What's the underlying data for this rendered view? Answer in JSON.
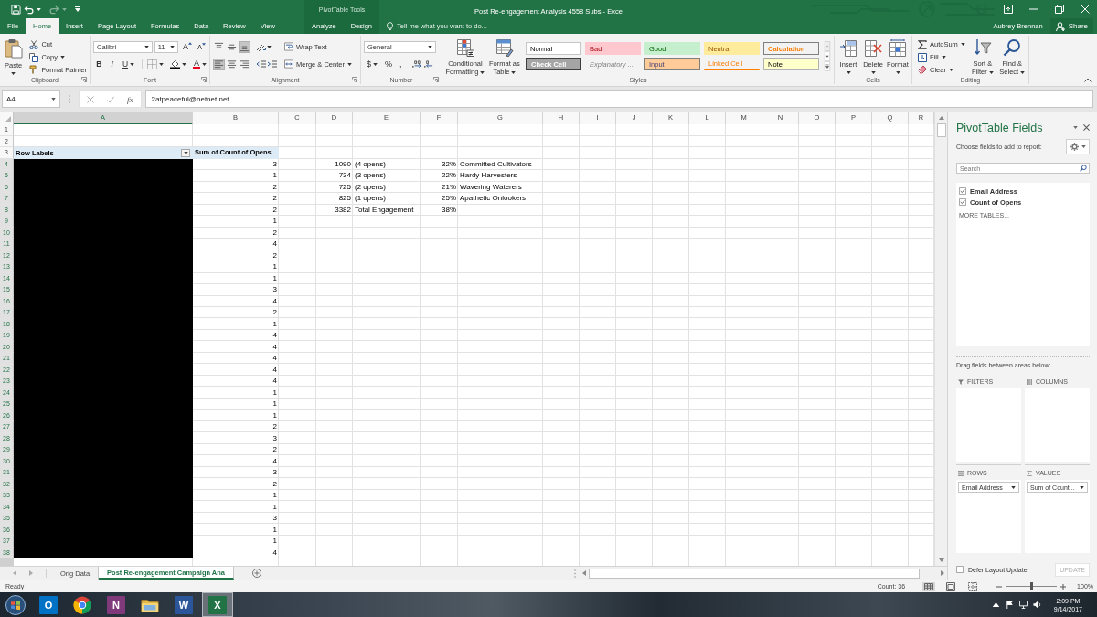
{
  "title_bar": {
    "title": "Post Re-engagement Analysis 4558 Subs - Excel"
  },
  "quick_access": [
    {
      "kind": "save",
      "disabled": false
    },
    {
      "kind": "undo",
      "disabled": false
    },
    {
      "kind": "redo",
      "disabled": true
    }
  ],
  "tabs": [
    {
      "label": "File",
      "selected": false
    },
    {
      "label": "Home",
      "selected": true
    },
    {
      "label": "Insert",
      "selected": false
    },
    {
      "label": "Page Layout",
      "selected": false
    },
    {
      "label": "Formulas",
      "selected": false
    },
    {
      "label": "Data",
      "selected": false
    },
    {
      "label": "Review",
      "selected": false
    },
    {
      "label": "View",
      "selected": false
    }
  ],
  "contextual_tab_group": {
    "label": "PivotTable Tools",
    "tabs": [
      {
        "label": "Analyze",
        "selected": false
      },
      {
        "label": "Design",
        "selected": false
      }
    ]
  },
  "tell_me": {
    "placeholder": "Tell me what you want to do..."
  },
  "account": {
    "user": "Aubrey Brennan",
    "share": "Share"
  },
  "ribbon": {
    "clipboard": {
      "paste": "Paste",
      "items": [
        {
          "label": "Cut",
          "kind": "cut"
        },
        {
          "label": "Copy",
          "kind": "copy"
        },
        {
          "label": "Format Painter",
          "kind": "painter"
        }
      ],
      "label": "Clipboard"
    },
    "font": {
      "name": "Calibri",
      "size": "11",
      "grow": "A",
      "shrink": "A",
      "styles": [
        {
          "label": "B",
          "kind": "bold"
        },
        {
          "label": "I",
          "kind": "italic"
        },
        {
          "label": "U",
          "kind": "underline"
        }
      ],
      "text_color_button": "A",
      "label": "Font"
    },
    "alignment": {
      "vertical": [
        {
          "kind": "top",
          "selected": false
        },
        {
          "kind": "middle",
          "selected": false
        },
        {
          "kind": "bottom",
          "selected": true
        }
      ],
      "horizontal": [
        {
          "kind": "left",
          "selected": true
        },
        {
          "kind": "center",
          "selected": false
        },
        {
          "kind": "right",
          "selected": false
        }
      ],
      "wrap_text": "Wrap Text",
      "merge": "Merge & Center",
      "label": "Alignment"
    },
    "number": {
      "format": "General",
      "symbols": [
        {
          "label": "$",
          "kind": "currency"
        },
        {
          "label": "%",
          "kind": "percent"
        },
        {
          "label": ",",
          "kind": "comma"
        }
      ],
      "label": "Number"
    },
    "styles": {
      "conditional": "Conditional Formatting",
      "format_table": "Format as Table",
      "cell_styles": [
        {
          "label": "Normal",
          "kind": "normal"
        },
        {
          "label": "Bad",
          "kind": "bad"
        },
        {
          "label": "Good",
          "kind": "good"
        },
        {
          "label": "Neutral",
          "kind": "neutral"
        },
        {
          "label": "Calculation",
          "kind": "calculation"
        },
        {
          "label": "Check Cell",
          "kind": "check"
        },
        {
          "label": "Explanatory ...",
          "kind": "explanatory"
        },
        {
          "label": "Input",
          "kind": "input"
        },
        {
          "label": "Linked Cell",
          "kind": "linked"
        },
        {
          "label": "Note",
          "kind": "note"
        }
      ],
      "label": "Styles"
    },
    "cells": {
      "buttons": [
        {
          "label": "Insert",
          "kind": "insert"
        },
        {
          "label": "Delete",
          "kind": "delete"
        },
        {
          "label": "Format",
          "kind": "format"
        }
      ],
      "label": "Cells"
    },
    "editing": {
      "items": [
        {
          "label": "AutoSum",
          "kind": "autosum"
        },
        {
          "label": "Fill",
          "kind": "fill"
        },
        {
          "label": "Clear",
          "kind": "clear"
        }
      ],
      "sort": "Sort & Filter",
      "find": "Find & Select",
      "label": "Editing"
    }
  },
  "formula_bar": {
    "name_box": "A4",
    "function_label": "fx",
    "value": "2atpeaceful@netnet.net"
  },
  "sheet": {
    "columns": [
      {
        "label": "A",
        "selected": true
      },
      {
        "label": "B",
        "selected": false
      },
      {
        "label": "C",
        "selected": false
      },
      {
        "label": "D",
        "selected": false
      },
      {
        "label": "E",
        "selected": false
      },
      {
        "label": "F",
        "selected": false
      },
      {
        "label": "G",
        "selected": false
      },
      {
        "label": "H",
        "selected": false
      },
      {
        "label": "I",
        "selected": false
      },
      {
        "label": "J",
        "selected": false
      },
      {
        "label": "K",
        "selected": false
      },
      {
        "label": "L",
        "selected": false
      },
      {
        "label": "M",
        "selected": false
      },
      {
        "label": "N",
        "selected": false
      },
      {
        "label": "O",
        "selected": false
      },
      {
        "label": "P",
        "selected": false
      },
      {
        "label": "Q",
        "selected": false
      },
      {
        "label": "R",
        "selected": false
      }
    ],
    "rows": [
      {
        "number": "1",
        "kind": "plain",
        "selected": false,
        "redacted": false
      },
      {
        "number": "2",
        "kind": "plain",
        "selected": false,
        "redacted": false
      },
      {
        "number": "3",
        "kind": "pivot_header",
        "selected": false,
        "redacted": false,
        "a": "Row Labels",
        "b": "Sum of Count of Opens"
      },
      {
        "number": "4",
        "kind": "plain",
        "selected": true,
        "redacted": true,
        "b": "3",
        "d": "1090",
        "e": "(4 opens)",
        "f": "32%",
        "g": "Committed Cultivators"
      },
      {
        "number": "5",
        "kind": "plain",
        "selected": true,
        "redacted": true,
        "b": "1",
        "d": "734",
        "e": "(3 opens)",
        "f": "22%",
        "g": "Hardy Harvesters"
      },
      {
        "number": "6",
        "kind": "plain",
        "selected": true,
        "redacted": true,
        "b": "2",
        "d": "725",
        "e": "(2 opens)",
        "f": "21%",
        "g": "Wavering Waterers"
      },
      {
        "number": "7",
        "kind": "plain",
        "selected": true,
        "redacted": true,
        "b": "2",
        "d": "825",
        "e": "(1 opens)",
        "f": "25%",
        "g": "Apathetic Onlookers"
      },
      {
        "number": "8",
        "kind": "plain",
        "selected": true,
        "redacted": true,
        "b": "2",
        "d": "3382",
        "e": "Total Engagement",
        "f": "38%"
      },
      {
        "number": "9",
        "kind": "plain",
        "selected": true,
        "redacted": true,
        "b": "1"
      },
      {
        "number": "10",
        "kind": "plain",
        "selected": true,
        "redacted": true,
        "b": "2"
      },
      {
        "number": "11",
        "kind": "plain",
        "selected": true,
        "redacted": true,
        "b": "4"
      },
      {
        "number": "12",
        "kind": "plain",
        "selected": true,
        "redacted": true,
        "b": "2"
      },
      {
        "number": "13",
        "kind": "plain",
        "selected": true,
        "redacted": true,
        "b": "1"
      },
      {
        "number": "14",
        "kind": "plain",
        "selected": true,
        "redacted": true,
        "b": "1"
      },
      {
        "number": "15",
        "kind": "plain",
        "selected": true,
        "redacted": true,
        "b": "3"
      },
      {
        "number": "16",
        "kind": "plain",
        "selected": true,
        "redacted": true,
        "b": "4"
      },
      {
        "number": "17",
        "kind": "plain",
        "selected": true,
        "redacted": true,
        "b": "2"
      },
      {
        "number": "18",
        "kind": "plain",
        "selected": true,
        "redacted": true,
        "b": "1"
      },
      {
        "number": "19",
        "kind": "plain",
        "selected": true,
        "redacted": true,
        "b": "4"
      },
      {
        "number": "20",
        "kind": "plain",
        "selected": true,
        "redacted": true,
        "b": "4"
      },
      {
        "number": "21",
        "kind": "plain",
        "selected": true,
        "redacted": true,
        "b": "4"
      },
      {
        "number": "22",
        "kind": "plain",
        "selected": true,
        "redacted": true,
        "b": "4"
      },
      {
        "number": "23",
        "kind": "plain",
        "selected": true,
        "redacted": true,
        "b": "4"
      },
      {
        "number": "24",
        "kind": "plain",
        "selected": true,
        "redacted": true,
        "b": "1"
      },
      {
        "number": "25",
        "kind": "plain",
        "selected": true,
        "redacted": true,
        "b": "1"
      },
      {
        "number": "26",
        "kind": "plain",
        "selected": true,
        "redacted": true,
        "b": "1"
      },
      {
        "number": "27",
        "kind": "plain",
        "selected": true,
        "redacted": true,
        "b": "2"
      },
      {
        "number": "28",
        "kind": "plain",
        "selected": true,
        "redacted": true,
        "b": "3"
      },
      {
        "number": "29",
        "kind": "plain",
        "selected": true,
        "redacted": true,
        "b": "2"
      },
      {
        "number": "30",
        "kind": "plain",
        "selected": true,
        "redacted": true,
        "b": "4"
      },
      {
        "number": "31",
        "kind": "plain",
        "selected": true,
        "redacted": true,
        "b": "3"
      },
      {
        "number": "32",
        "kind": "plain",
        "selected": true,
        "redacted": true,
        "b": "2"
      },
      {
        "number": "33",
        "kind": "plain",
        "selected": true,
        "redacted": true,
        "b": "1"
      },
      {
        "number": "34",
        "kind": "plain",
        "selected": true,
        "redacted": true,
        "b": "1"
      },
      {
        "number": "35",
        "kind": "plain",
        "selected": true,
        "redacted": true,
        "b": "3"
      },
      {
        "number": "36",
        "kind": "plain",
        "selected": true,
        "redacted": true,
        "b": "1"
      },
      {
        "number": "37",
        "kind": "plain",
        "selected": true,
        "redacted": true,
        "b": "1"
      },
      {
        "number": "38",
        "kind": "plain",
        "selected": true,
        "redacted": true,
        "b": "4"
      }
    ]
  },
  "sheet_tabs": [
    {
      "label": "Orig Data",
      "selected": false
    },
    {
      "label": "Post Re-engagement Campaign Ana",
      "selected": true
    }
  ],
  "pivot_panel": {
    "title": "PivotTable Fields",
    "instruction": "Choose fields to add to report:",
    "search": {
      "placeholder": "Search"
    },
    "fields": [
      {
        "label": "Email Address",
        "checked": true
      },
      {
        "label": "Count of Opens",
        "checked": true
      }
    ],
    "more_tables": "MORE TABLES...",
    "drag_hint": "Drag fields between areas below:",
    "areas": [
      {
        "kind": "filters",
        "label": "FILTERS"
      },
      {
        "kind": "columns",
        "label": "COLUMNS"
      },
      {
        "kind": "rows",
        "label": "ROWS",
        "items": [
          "Email Address"
        ]
      },
      {
        "kind": "values",
        "label": "VALUES",
        "items": [
          "Sum of Count..."
        ]
      }
    ],
    "defer": {
      "label": "Defer Layout Update",
      "checked": false
    },
    "update": {
      "label": "UPDATE",
      "disabled": true
    }
  },
  "status_bar": {
    "mode": "Ready",
    "count": "Count: 36",
    "views": [
      {
        "kind": "normal",
        "selected": true
      },
      {
        "kind": "page_layout",
        "selected": false
      },
      {
        "kind": "page_break",
        "selected": false
      }
    ],
    "zoom": {
      "level": 0.5,
      "label": "100%"
    }
  },
  "taskbar": {
    "apps": [
      {
        "kind": "mail",
        "glyph": "O",
        "active": false
      },
      {
        "kind": "browser",
        "active": false
      },
      {
        "kind": "notes",
        "glyph": "N",
        "active": false
      },
      {
        "kind": "folder",
        "active": false
      },
      {
        "kind": "writer",
        "glyph": "W",
        "active": false
      },
      {
        "kind": "sheets",
        "glyph": "X",
        "active": true
      }
    ],
    "time": "2:09 PM",
    "date": "9/14/2017"
  }
}
